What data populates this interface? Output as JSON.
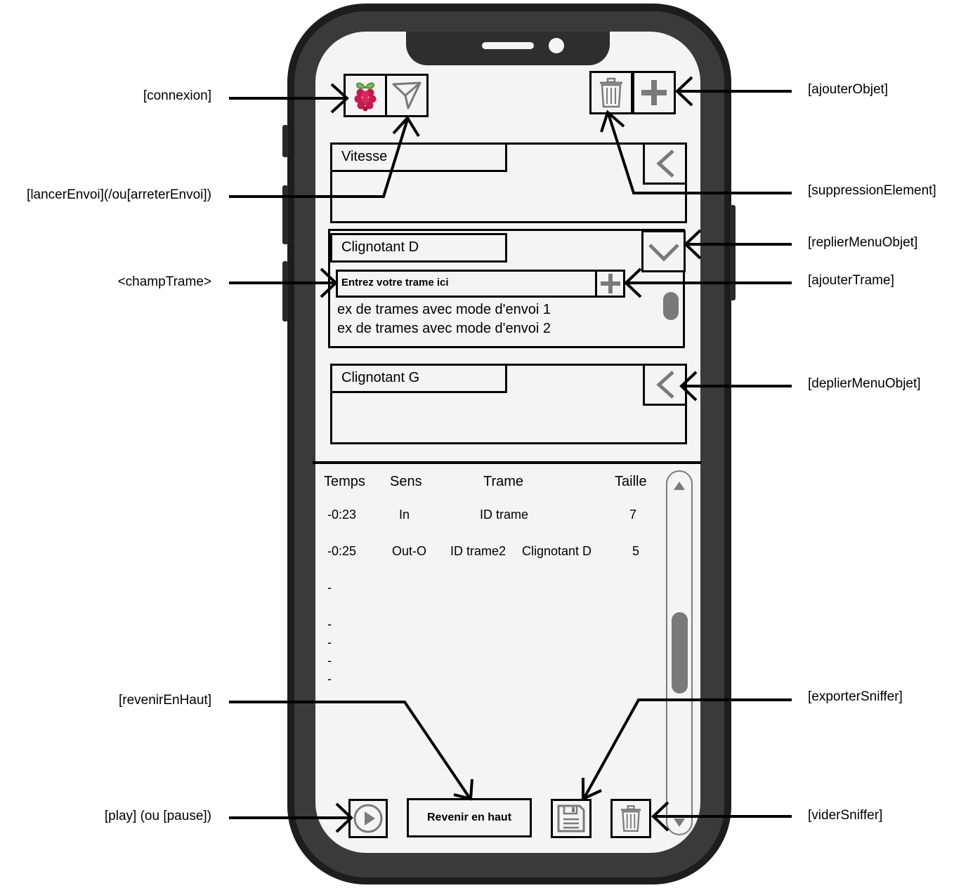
{
  "annotations": {
    "connexion": "[connexion]",
    "lancer_envoi": "[lancerEnvoi](/ou[arreterEnvoi])",
    "champ_trame": "<champTrame>",
    "revenir_en_haut": "[revenirEnHaut]",
    "play": "[play] (ou [pause])",
    "ajouter_objet": "[ajouterObjet]",
    "suppression_element": "[suppressionElement]",
    "replier_menu_objet": "[replierMenuObjet]",
    "ajouter_trame": "[ajouterTrame]",
    "deplier_menu_objet": "[deplierMenuObjet]",
    "exporter_sniffer": "[exporterSniffer]",
    "vider_sniffer": "[viderSniffer]"
  },
  "toolbar": {
    "connect_icon": "raspberry-icon",
    "send_icon": "send-icon",
    "delete_icon": "trash-icon",
    "add_icon": "plus-icon"
  },
  "objects": [
    {
      "name": "Vitesse",
      "state": "collapsed"
    },
    {
      "name": "Clignotant D",
      "state": "expanded",
      "frame_placeholder": "Entrez votre trame ici",
      "examples": [
        "ex de trames avec mode d'envoi 1",
        "ex de trames avec mode d'envoi 2"
      ]
    },
    {
      "name": "Clignotant G",
      "state": "collapsed"
    }
  ],
  "sniffer": {
    "headers": [
      "Temps",
      "Sens",
      "Trame",
      "Taille"
    ],
    "rows": [
      {
        "temps": "-0:23",
        "sens": "In",
        "trame": "ID trame",
        "objet": "",
        "taille": "7"
      },
      {
        "temps": "-0:25",
        "sens": "Out-O",
        "trame": "ID trame2",
        "objet": "Clignotant D",
        "taille": "5"
      }
    ],
    "placeholder_rows": [
      "-",
      "-",
      "-",
      "-",
      "-"
    ]
  },
  "bottom_bar": {
    "back_to_top_label": "Revenir en haut",
    "play_icon": "play-icon",
    "export_icon": "save-icon",
    "clear_icon": "trash-icon"
  },
  "colors": {
    "phone_frame": "#1d1d1d",
    "screen": "#f4f4f4",
    "icon_gray": "#7a7a7a",
    "raspberry_red": "#c51a4a",
    "leaf_green": "#6cc04a"
  }
}
